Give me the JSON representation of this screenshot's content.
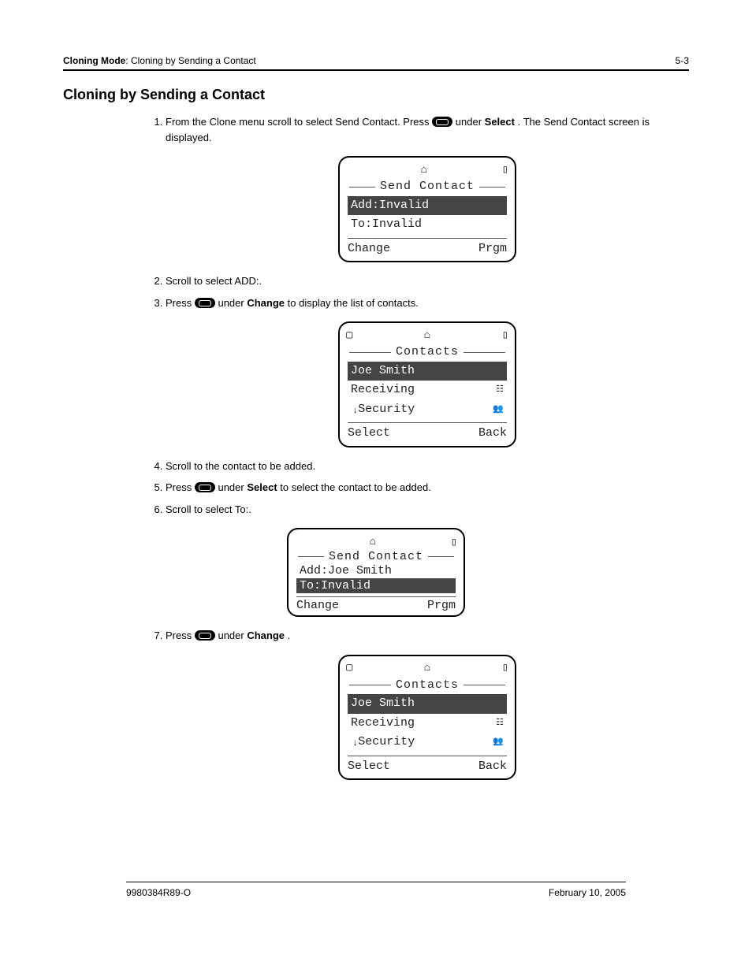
{
  "header": {
    "section_bold": "Cloning Mode",
    "section_rest": ": Cloning by Sending a Contact",
    "pagenum": "5-3"
  },
  "title": "Cloning by Sending a Contact",
  "steps": {
    "s1a": "From the Clone menu scroll to select Send Contact. Press ",
    "s1b": " under ",
    "s1c": "Select",
    "s1d": ". The Send Contact screen is displayed.",
    "s2": "Scroll to select ADD:.",
    "s3a": "Press ",
    "s3b": " under ",
    "s3c": "Change",
    "s3d": " to display the list of contacts.",
    "s4": "Scroll to the contact to be added.",
    "s5a": "Press ",
    "s5b": " under ",
    "s5c": "Select",
    "s5d": " to select the contact to be added.",
    "s6": "Scroll to select To:.",
    "s7a": "Press ",
    "s7b": " under ",
    "s7c": "Change",
    "s7d": "."
  },
  "lcd1": {
    "title": "Send Contact",
    "row1": "Add:Invalid",
    "row2": "To:Invalid",
    "left": "Change",
    "right": "Prgm"
  },
  "lcd2": {
    "title": "Contacts",
    "row1": "Joe Smith",
    "row2": "Receiving",
    "row3": "Security",
    "left": "Select",
    "right": "Back"
  },
  "lcd3": {
    "title": "Send Contact",
    "row1": "Add:Joe Smith",
    "row2": "To:Invalid",
    "left": "Change",
    "right": "Prgm"
  },
  "lcd4": {
    "title": "Contacts",
    "row1": "Joe Smith",
    "row2": "Receiving",
    "row3": "Security",
    "left": "Select",
    "right": "Back"
  },
  "footer": {
    "left": "9980384R89-O",
    "right": "February 10, 2005"
  }
}
